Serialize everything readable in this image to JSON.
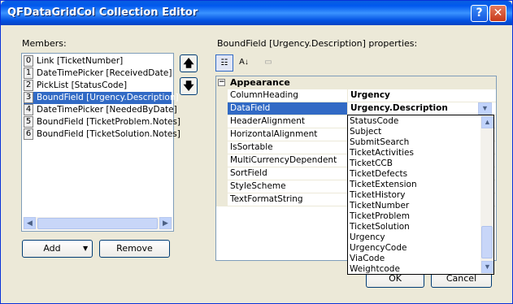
{
  "window": {
    "title": "QFDataGridCol Collection Editor",
    "help_label": "?",
    "close_label": "✕"
  },
  "members": {
    "label": "Members:",
    "items": [
      {
        "index": "0",
        "text": "Link [TicketNumber]"
      },
      {
        "index": "1",
        "text": "DateTimePicker [ReceivedDate]"
      },
      {
        "index": "2",
        "text": "PickList [StatusCode]"
      },
      {
        "index": "3",
        "text": "BoundField [Urgency.Description]"
      },
      {
        "index": "4",
        "text": "DateTimePicker [NeededByDate]"
      },
      {
        "index": "5",
        "text": "BoundField [TicketProblem.Notes]"
      },
      {
        "index": "6",
        "text": "BoundField [TicketSolution.Notes]"
      }
    ],
    "selected_index": 3
  },
  "order": {
    "up_label": "🡅",
    "down_label": "🡇"
  },
  "buttons": {
    "add": "Add",
    "remove": "Remove",
    "ok": "OK",
    "cancel": "Cancel"
  },
  "properties": {
    "label": "BoundField [Urgency.Description] properties:",
    "category": "Appearance",
    "rows": [
      {
        "name": "ColumnHeading",
        "value": "Urgency"
      },
      {
        "name": "DataField",
        "value": "Urgency.Description"
      },
      {
        "name": "HeaderAlignment",
        "value": ""
      },
      {
        "name": "HorizontalAlignment",
        "value": ""
      },
      {
        "name": "IsSortable",
        "value": ""
      },
      {
        "name": "MultiCurrencyDependent",
        "value": ""
      },
      {
        "name": "SortField",
        "value": ""
      },
      {
        "name": "StyleScheme",
        "value": ""
      },
      {
        "name": "TextFormatString",
        "value": ""
      }
    ]
  },
  "dropdown": {
    "options": [
      "StatusCode",
      "Subject",
      "SubmitSearch",
      "TicketActivities",
      "TicketCCB",
      "TicketDefects",
      "TicketExtension",
      "TicketHistory",
      "TicketNumber",
      "TicketProblem",
      "TicketSolution",
      "Urgency",
      "UrgencyCode",
      "ViaCode",
      "Weightcode"
    ]
  },
  "colors": {
    "selection": "#316AC5",
    "titlebar": "#0058EE",
    "dialog": "#ECE9D8"
  }
}
